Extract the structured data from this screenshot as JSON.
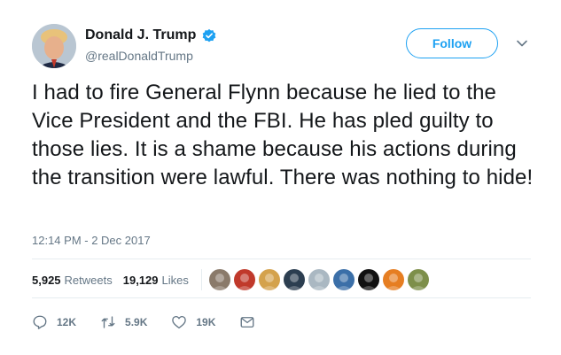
{
  "author": {
    "name": "Donald J. Trump",
    "handle": "@realDonaldTrump",
    "verified_icon": "verified-badge-icon"
  },
  "follow_label": "Follow",
  "tweet": {
    "text": "I had to fire General Flynn because he lied to the Vice President and the FBI. He has pled guilty to those lies. It is a shame because his actions during the transition were lawful. There was nothing to hide!",
    "timestamp": "12:14 PM - 2 Dec 2017"
  },
  "stats": {
    "retweets_count": "5,925",
    "retweets_label": "Retweets",
    "likes_count": "19,129",
    "likes_label": "Likes"
  },
  "likers": [
    {
      "color": "#8a7a6a"
    },
    {
      "color": "#c0392b"
    },
    {
      "color": "#d4a24c"
    },
    {
      "color": "#2c3e50"
    },
    {
      "color": "#aab8c2"
    },
    {
      "color": "#3b6fa8"
    },
    {
      "color": "#111111"
    },
    {
      "color": "#e67e22"
    },
    {
      "color": "#7d8f4a"
    }
  ],
  "actions": {
    "reply": "12K",
    "retweet": "5.9K",
    "like": "19K"
  },
  "colors": {
    "accent": "#1da1f2",
    "muted": "#657786",
    "text": "#14171a"
  }
}
